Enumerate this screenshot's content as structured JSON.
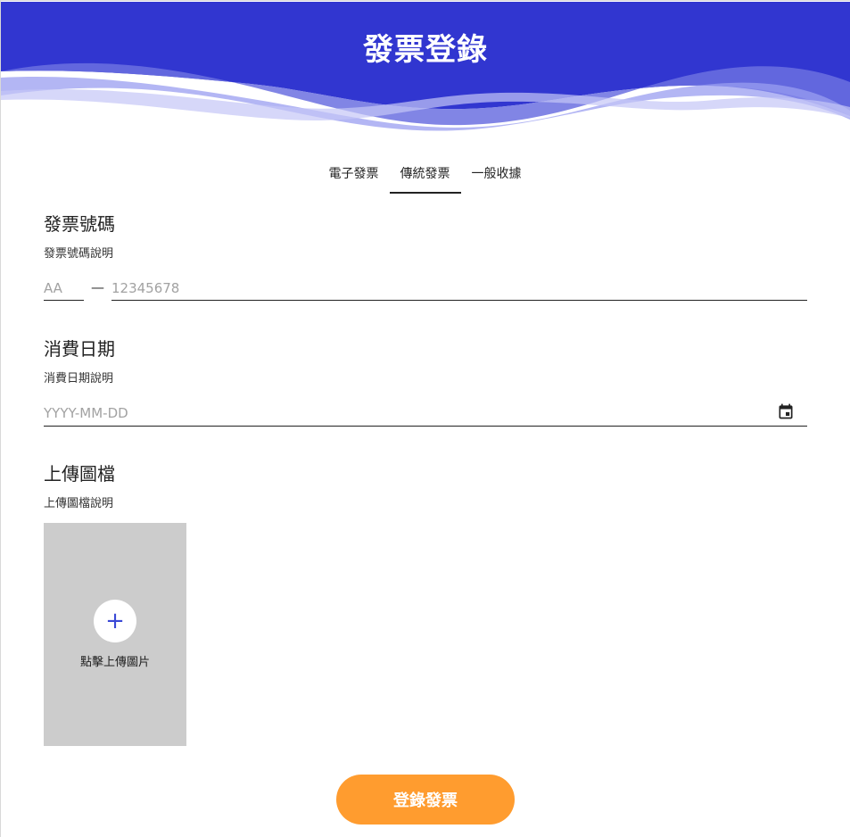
{
  "header": {
    "title": "發票登錄"
  },
  "tabs": [
    {
      "label": "電子發票",
      "active": false
    },
    {
      "label": "傳統發票",
      "active": true
    },
    {
      "label": "一般收據",
      "active": false
    }
  ],
  "invoice_number": {
    "title": "發票號碼",
    "description": "發票號碼說明",
    "prefix_placeholder": "AA",
    "separator": "—",
    "number_placeholder": "12345678"
  },
  "purchase_date": {
    "title": "消費日期",
    "description": "消費日期說明",
    "placeholder": "YYYY-MM-DD",
    "icon": "calendar-icon"
  },
  "upload": {
    "title": "上傳圖檔",
    "description": "上傳圖檔說明",
    "button_label": "點擊上傳圖片",
    "icon": "plus-icon"
  },
  "submit": {
    "label": "登錄發票"
  },
  "colors": {
    "header": "#3136d0",
    "accent": "#ff9c2f",
    "upload_bg": "#cccccc"
  }
}
